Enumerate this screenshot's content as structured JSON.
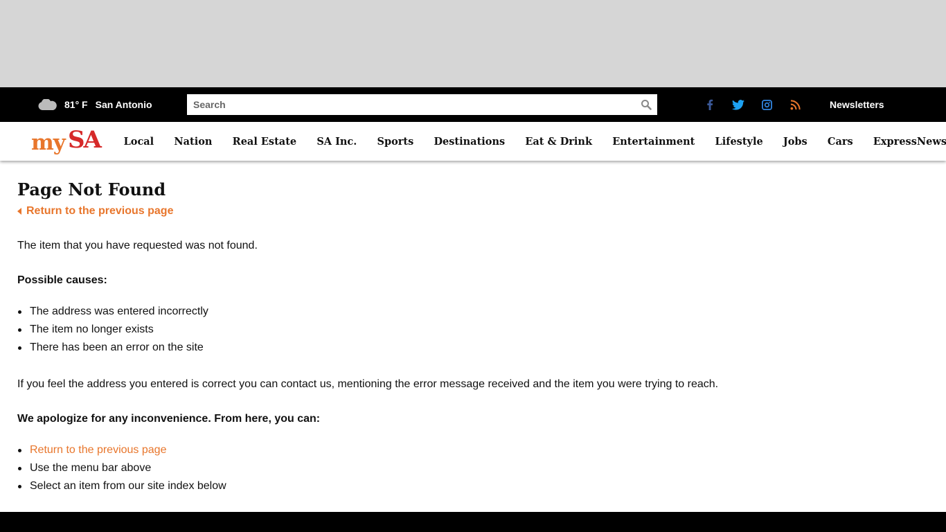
{
  "weather": {
    "icon": "cloud-icon",
    "temp": "81° F",
    "city": "San Antonio"
  },
  "search": {
    "placeholder": "Search",
    "icon": "search-icon"
  },
  "social": [
    {
      "name": "facebook-icon",
      "color": "#3b5998"
    },
    {
      "name": "twitter-icon",
      "color": "#1da1f2"
    },
    {
      "name": "instagram-icon",
      "color": "#2f7fd6"
    },
    {
      "name": "rss-icon",
      "color": "#e8762c"
    }
  ],
  "header": {
    "newsletters": "Newsletters"
  },
  "logo": {
    "my": "my",
    "sa": "SA"
  },
  "nav": {
    "items": [
      "Local",
      "Nation",
      "Real Estate",
      "SA Inc.",
      "Sports",
      "Destinations",
      "Eat & Drink",
      "Entertainment",
      "Lifestyle",
      "Jobs",
      "Cars",
      "ExpressNews.com"
    ]
  },
  "main": {
    "title": "Page Not Found",
    "back_link": "Return to the previous page",
    "intro": "The item that you have requested was not found.",
    "causes_heading": "Possible causes:",
    "causes": [
      "The address was entered incorrectly",
      "The item no longer exists",
      "There has been an error on the site"
    ],
    "contact_text": "If you feel the address you entered is correct you can contact us, mentioning the error message received and the item you were trying to reach.",
    "options_heading": "We apologize for any inconvenience. From here, you can:",
    "options": [
      "Return to the previous page",
      "Use the menu bar above",
      "Select an item from our site index below"
    ]
  },
  "colors": {
    "accent": "#e8762c",
    "logo_red": "#d62a2a",
    "topbar": "#000000",
    "ad_bg": "#d6d6d6"
  }
}
